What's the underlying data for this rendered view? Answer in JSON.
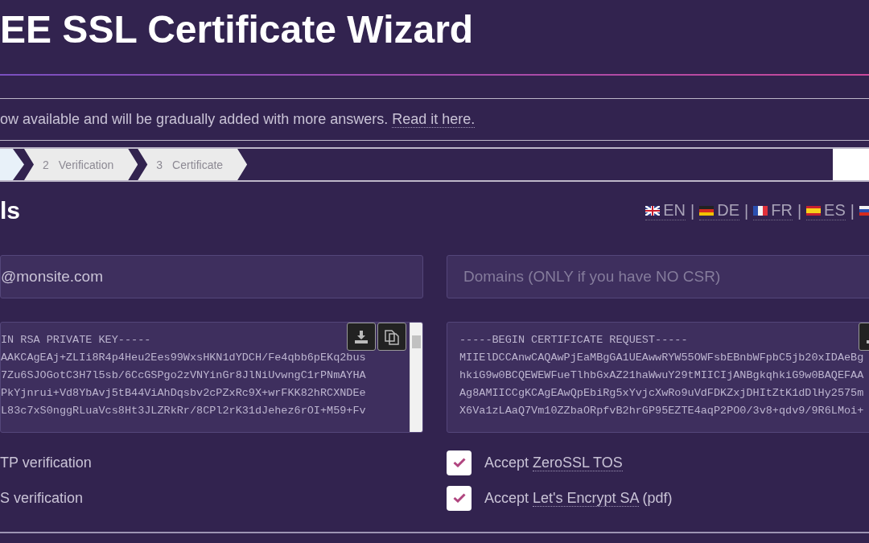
{
  "header": {
    "title": "EE SSL Certificate Wizard"
  },
  "notice": {
    "text": "ow available and will be gradually added with more answers.",
    "link": "Read it here."
  },
  "steps": [
    {
      "selected": true
    },
    {
      "number": "2",
      "label": "Verification",
      "selected": false
    },
    {
      "number": "3",
      "label": "Certificate",
      "selected": false
    }
  ],
  "section_title": "ls",
  "languages": [
    {
      "kind": "uk",
      "code": "EN"
    },
    {
      "kind": "de",
      "code": "DE",
      "separator": "|"
    },
    {
      "kind": "fr",
      "code": "FR",
      "separator": "|"
    },
    {
      "kind": "es",
      "code": "ES",
      "separator": "|"
    },
    {
      "kind": "ru",
      "separator": "|"
    }
  ],
  "email_field": {
    "value": "@monsite.com"
  },
  "domains_field": {
    "placeholder": "Domains (ONLY if you have NO CSR)"
  },
  "private_key": {
    "lines": [
      "IN RSA PRIVATE KEY-----",
      "AAKCAgEAj+ZLIi8R4p4Heu2Ees99WxsHKN1dYDCH/Fe4qbb6pEKq2bus",
      "7Zu6SJOGotC3H7l5sb/6CcGSPgo2zVNYinGr8JlNiUvwngC1rPNmAYHA",
      "PkYjnrui+Vd8YbAvj5tB44ViAhDqsbv2cPZxRc9X+wrFKK82hRCXNDEe",
      "L83c7xS0nggRLuaVcs8Ht3JLZRkRr/8CPl2rK31dJehez6rOI+M59+Fv"
    ]
  },
  "csr": {
    "lines": [
      "-----BEGIN CERTIFICATE REQUEST-----",
      "MIIElDCCAnwCAQAwPjEaMBgGA1UEAwwRYW55OWFsbEBnbWFpbC5jb20xIDAeBg",
      "hkiG9w0BCQEWEWFueTlhbGxAZ21haWwuY29tMIICIjANBgkqhkiG9w0BAQEFAA",
      "Ag8AMIICCgKCAgEAwQpEbiRg5xYvjcXwRo9uVdFDKZxjDHItZtK1dDlHy2575m",
      "X6Va1zLAaQ7Vm10ZZbaORpfvB2hrGP95EZTE4aqP2PO0/3v8+qdv9/9R6LMoi+"
    ]
  },
  "verification_options": [
    "TP verification",
    "S verification"
  ],
  "agreements": [
    {
      "prefix": "Accept",
      "link": "ZeroSSL TOS",
      "checked": true
    },
    {
      "prefix": "Accept",
      "link": "Let's Encrypt SA",
      "suffix": "(pdf)",
      "checked": true
    }
  ]
}
